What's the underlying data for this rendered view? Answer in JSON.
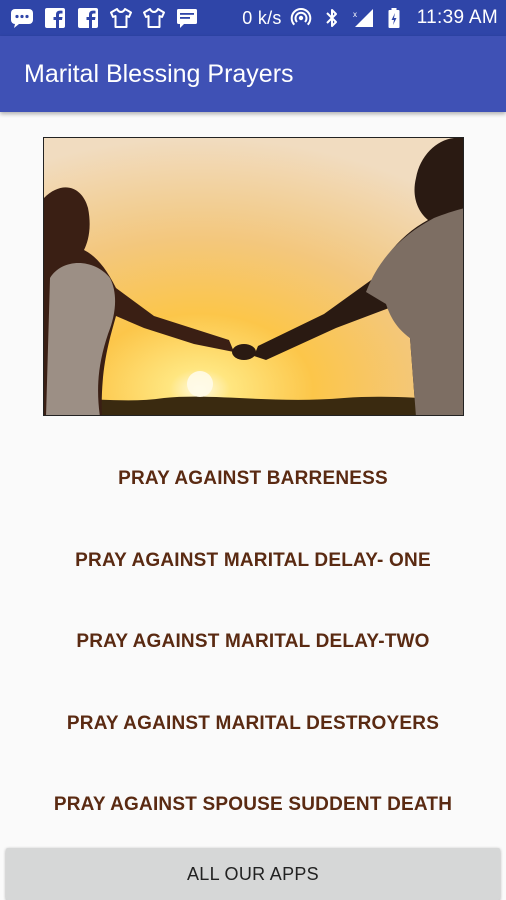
{
  "status_bar": {
    "left_icons": [
      "chat-bubble-icon",
      "facebook-icon",
      "facebook-icon",
      "tshirt-icon",
      "tshirt-icon",
      "message-icon"
    ],
    "network_speed": "0 k/s",
    "right_icons": [
      "hotspot-icon",
      "bluetooth-icon",
      "signal-icon",
      "battery-icon"
    ],
    "time": "11:39 AM"
  },
  "app_bar": {
    "title": "Marital Blessing Prayers",
    "color": "#3f51b5"
  },
  "hero_image": {
    "alt": "Couple holding hands at sunset"
  },
  "menu": {
    "text_color": "#5a2a12",
    "items": [
      {
        "label": "PRAY AGAINST BARRENESS"
      },
      {
        "label": "PRAY AGAINST MARITAL DELAY- ONE"
      },
      {
        "label": "PRAY AGAINST MARITAL DELAY-TWO"
      },
      {
        "label": "PRAY AGAINST MARITAL DESTROYERS"
      },
      {
        "label": "PRAY AGAINST SPOUSE SUDDENT DEATH"
      }
    ]
  },
  "footer": {
    "button_label": "ALL OUR APPS"
  }
}
